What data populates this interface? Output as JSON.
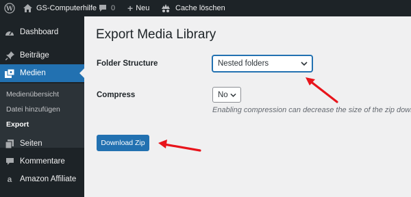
{
  "adminbar": {
    "site_name": "GS-Computerhilfe",
    "comments_count": "0",
    "new_label": "Neu",
    "cache_label": "Cache löschen"
  },
  "sidebar": {
    "items": [
      {
        "label": "Dashboard",
        "icon": "dashboard-icon"
      },
      {
        "label": "Beiträge",
        "icon": "pin-icon"
      },
      {
        "label": "Medien",
        "icon": "media-icon"
      },
      {
        "label": "Seiten",
        "icon": "pages-icon"
      },
      {
        "label": "Kommentare",
        "icon": "comment-icon"
      },
      {
        "label": "Amazon Affiliate",
        "icon": "amazon-icon"
      }
    ],
    "submenu": [
      {
        "label": "Medienübersicht"
      },
      {
        "label": "Datei hinzufügen"
      },
      {
        "label": "Export"
      }
    ]
  },
  "main": {
    "title": "Export Media Library",
    "folder_structure_label": "Folder Structure",
    "folder_structure_value": "Nested folders",
    "compress_label": "Compress",
    "compress_value": "No",
    "compress_description": "Enabling compression can decrease the size of the zip download",
    "download_button": "Download Zip"
  },
  "colors": {
    "admin_dark": "#1d2327",
    "accent": "#2271b1",
    "annotation_arrow": "#e8141b"
  }
}
